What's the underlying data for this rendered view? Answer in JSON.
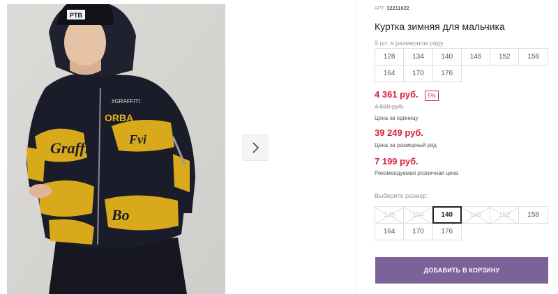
{
  "product": {
    "art_label": "АРТ.",
    "art_value": "32211022",
    "title": "Куртка зимняя для мальчика",
    "size_row_note": "9 шт. в размерном ряду",
    "size_row": [
      "128",
      "134",
      "140",
      "146",
      "152",
      "158",
      "164",
      "170",
      "176"
    ]
  },
  "pricing": {
    "unit_price": "4 361 руб.",
    "discount_badge": "5%",
    "old_price": "4 590 руб.",
    "unit_caption": "Цена за единицу",
    "row_price": "39 249 руб.",
    "row_caption": "Цена за размерный ряд",
    "retail_price": "7 199 руб.",
    "retail_caption": "Рекомендуемая розничная цена"
  },
  "size_picker": {
    "label": "Выберите размер:",
    "options": [
      {
        "label": "128",
        "state": "disabled"
      },
      {
        "label": "134",
        "state": "disabled"
      },
      {
        "label": "140",
        "state": "selected"
      },
      {
        "label": "146",
        "state": "disabled"
      },
      {
        "label": "152",
        "state": "disabled"
      },
      {
        "label": "158",
        "state": "available"
      },
      {
        "label": "164",
        "state": "available"
      },
      {
        "label": "170",
        "state": "available"
      },
      {
        "label": "176",
        "state": "available"
      }
    ]
  },
  "actions": {
    "add_to_cart": "ДОБАВИТЬ В КОРЗИНУ"
  },
  "gallery": {
    "next_icon": "chevron-right-icon",
    "photo_hat_text": "PTB",
    "photo_chest_text": "#GRAFFITI",
    "photo_graffiti_words": [
      "Graffiti",
      "Fvi",
      "Bo",
      "ORBA"
    ]
  },
  "colors": {
    "price_red": "#d4233a",
    "button_purple": "#7b6299",
    "jacket_navy": "#1b1c2a",
    "graffiti_yellow": "#e3b21b"
  }
}
